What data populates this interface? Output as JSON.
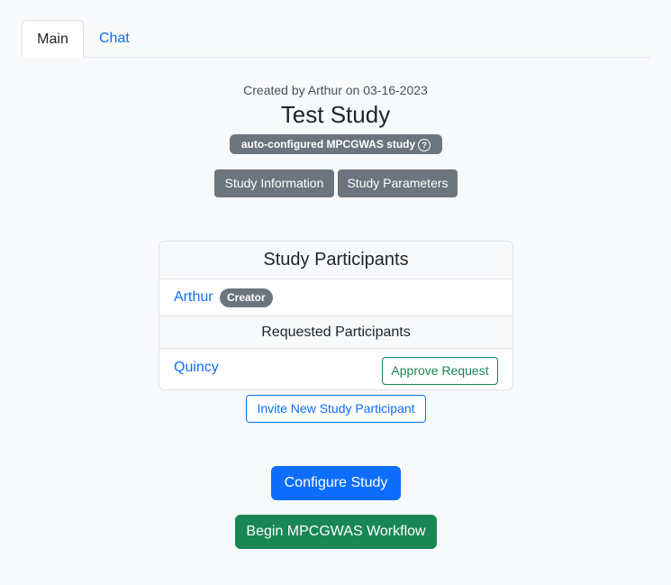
{
  "tabs": [
    {
      "label": "Main",
      "active": true
    },
    {
      "label": "Chat",
      "active": false
    }
  ],
  "study": {
    "created_text": "Created by Arthur on 03-16-2023",
    "title": "Test Study",
    "badge": "auto-configured MPCGWAS study",
    "help_icon": "question-circle-icon",
    "buttons": {
      "information": "Study Information",
      "parameters": "Study Parameters"
    }
  },
  "participants": {
    "heading": "Study Participants",
    "members": [
      {
        "name": "Arthur",
        "badge": "Creator"
      }
    ],
    "requested_heading": "Requested Participants",
    "requested": [
      {
        "name": "Quincy",
        "action": "Approve Request"
      }
    ],
    "invite_label": "Invite New Study Participant"
  },
  "actions": {
    "configure": "Configure Study",
    "begin": "Begin MPCGWAS Workflow"
  },
  "colors": {
    "primary": "#0d6efd",
    "success": "#198754",
    "secondary": "#6c757d"
  }
}
